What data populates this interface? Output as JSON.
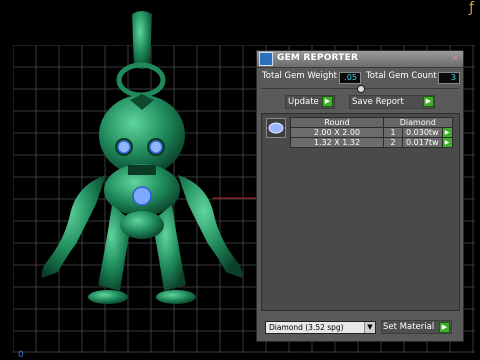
{
  "viewport": {
    "corner_glyph": "ƒ",
    "origin_label": "0"
  },
  "panel": {
    "title": "GEM REPORTER",
    "close_glyph": "×",
    "total_weight_label": "Total Gem Weight",
    "total_weight_value": ".05",
    "total_count_label": "Total Gem Count",
    "total_count_value": "3",
    "update_label": "Update",
    "save_report_label": "Save Report",
    "go_glyph": "▶",
    "table": {
      "headers": [
        "Round",
        "Diamond"
      ],
      "rows": [
        {
          "size": "2.00 X 2.00",
          "count": "1",
          "weight": "0.030tw"
        },
        {
          "size": "1.32 X 1.32",
          "count": "2",
          "weight": "0.017tw"
        }
      ]
    },
    "material_select": "Diamond    (3.52 spg)",
    "set_material_label": "Set Material"
  },
  "colors": {
    "figure": "#1f8a5c",
    "accent_green": "#3fae2a",
    "cyan_text": "#34e0f0",
    "grid": "#3a3a3a"
  }
}
